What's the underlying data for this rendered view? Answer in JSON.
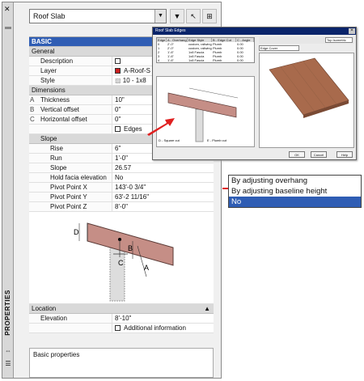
{
  "palette": {
    "title": "PROPERTIES",
    "object_type": "Roof Slab",
    "footer": "Basic properties"
  },
  "tabs": {
    "basic": "BASIC"
  },
  "general": {
    "header": "General",
    "rows": [
      {
        "label": "Description",
        "value": ""
      },
      {
        "label": "Layer",
        "value": "A-Roof-S"
      },
      {
        "label": "Style",
        "value": "10 - 1x8"
      }
    ]
  },
  "dimensions": {
    "header": "Dimensions",
    "rows": [
      {
        "letter": "A",
        "label": "Thickness",
        "value": "10\""
      },
      {
        "letter": "B",
        "label": "Vertical offset",
        "value": "0\""
      },
      {
        "letter": "C",
        "label": "Horizontal offset",
        "value": "0\""
      },
      {
        "letter": "",
        "label": "",
        "value": "Edges"
      }
    ]
  },
  "slope": {
    "header": "Slope",
    "rows": [
      {
        "label": "Rise",
        "value": "6\""
      },
      {
        "label": "Run",
        "value": "1'-0\""
      },
      {
        "label": "Slope",
        "value": "26.57"
      },
      {
        "label": "Hold facia elevation",
        "value": "No"
      },
      {
        "label": "Pivot Point X",
        "value": "143'-0 3/4\""
      },
      {
        "label": "Pivot Point Y",
        "value": "63'-2 11/16\""
      },
      {
        "label": "Pivot Point Z",
        "value": "8'-0\""
      }
    ]
  },
  "diagram_labels": {
    "d": "D",
    "a": "A",
    "b": "B",
    "c": "C"
  },
  "location": {
    "header": "Location",
    "rows": [
      {
        "label": "Elevation",
        "value": "8'-10\""
      },
      {
        "label": "",
        "value": "Additional information"
      }
    ]
  },
  "dialog": {
    "title": "Roof Slab Edges",
    "columns": [
      "Edge",
      "A - Overhang",
      "Edge Style",
      "B - Edge Cut",
      "C - Angle"
    ],
    "rows": [
      [
        "0",
        "2'-0\"",
        "custom, railwing",
        "Plumb",
        "0.00"
      ],
      [
        "1",
        "2'-0\"",
        "custom, railwing",
        "Plumb",
        "0.00"
      ],
      [
        "2",
        "1'-6\"",
        "1x8 Fascia",
        "Plumb",
        "0.00"
      ],
      [
        "3",
        "1'-6\"",
        "1x8 Fascia",
        "Plumb",
        "0.00"
      ],
      [
        "4",
        "1'-6\"",
        "1x8 Fascia",
        "Plumb",
        "0.00"
      ]
    ],
    "view_select": "Top Isometric",
    "style_select": "Edge Cover",
    "legend_d": "D - Square cut",
    "legend_e": "E - Plumb cut",
    "ok": "OK",
    "cancel": "Cancel",
    "help": "Help"
  },
  "dropdown": {
    "options": [
      "By adjusting overhang",
      "By adjusting baseline height",
      "No"
    ]
  },
  "colors": {
    "accent": "#2f5db4",
    "arrow": "#e02020",
    "roof": "#b77a70",
    "layer_swatch": "#cc2020"
  }
}
